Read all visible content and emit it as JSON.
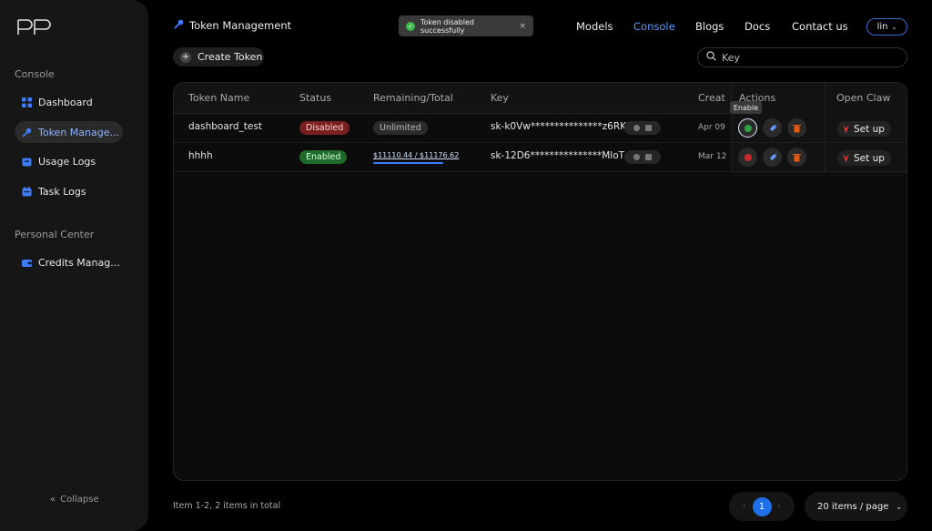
{
  "sidebar": {
    "sections": [
      {
        "label": "Console"
      },
      {
        "label": "Personal Center"
      }
    ],
    "items": [
      {
        "label": "Dashboard",
        "icon": "grid-icon"
      },
      {
        "label": "Token Manage...",
        "icon": "key-icon"
      },
      {
        "label": "Usage Logs",
        "icon": "box-icon"
      },
      {
        "label": "Task Logs",
        "icon": "calendar-icon"
      },
      {
        "label": "Credits Manag...",
        "icon": "wallet-icon"
      }
    ],
    "collapse_label": "Collapse"
  },
  "header": {
    "title": "Token Management",
    "nav": [
      "Models",
      "Console",
      "Blogs",
      "Docs",
      "Contact us"
    ],
    "active_nav": "Console",
    "user": "lin"
  },
  "toast": {
    "message": "Token disabled successfully"
  },
  "toolbar": {
    "create_label": "Create Token",
    "search_placeholder": "Key"
  },
  "table": {
    "columns": [
      "Token Name",
      "Status",
      "Remaining/Total",
      "Key",
      "Creat",
      "Actions",
      "Open Claw"
    ],
    "rows": [
      {
        "name": "dashboard_test",
        "status": "Disabled",
        "quota": "Unlimited",
        "key": "sk-k0Vw***************z6RK",
        "created": "Apr 09",
        "toggle_color": "#2f9e44",
        "setup": "Set up"
      },
      {
        "name": "hhhh",
        "status": "Enabled",
        "quota": "$11110.44 / $11176.62",
        "quota_fraction": 0.994,
        "key": "sk-12D6***************MloT",
        "created": "Mar 12",
        "toggle_color": "#c92a2a",
        "setup": "Set up"
      }
    ]
  },
  "tooltip": "Enable",
  "footer": {
    "info": "Item 1-2, 2 items in total",
    "page": "1",
    "per_page": "20 items / page"
  },
  "colors": {
    "accent": "#1e6fe8",
    "disabled": "#7a1f1f",
    "enabled": "#1f6a2a"
  }
}
